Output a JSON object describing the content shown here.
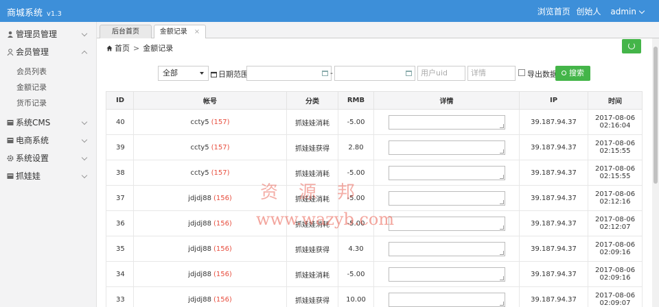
{
  "app": {
    "title": "商城系统",
    "version": "v1.3"
  },
  "topbar": {
    "links": [
      "浏览首页",
      "创始人",
      "admin"
    ]
  },
  "sidebar": {
    "items": [
      {
        "label": "管理员管理",
        "icon": "user-icon",
        "expanded": false
      },
      {
        "label": "会员管理",
        "icon": "member-icon",
        "expanded": true,
        "children": [
          "会员列表",
          "金额记录",
          "货币记录"
        ]
      },
      {
        "label": "系统CMS",
        "icon": "cms-icon",
        "expanded": false
      },
      {
        "label": "电商系统",
        "icon": "shop-icon",
        "expanded": false
      },
      {
        "label": "系统设置",
        "icon": "gear-icon",
        "expanded": false
      },
      {
        "label": "抓娃娃",
        "icon": "doll-icon",
        "expanded": false
      }
    ]
  },
  "tabs": [
    {
      "label": "后台首页",
      "active": false
    },
    {
      "label": "金额记录",
      "active": true,
      "close": "×"
    }
  ],
  "breadcrumb": {
    "home": "首页",
    "sep": ">",
    "current": "金额记录"
  },
  "filters": {
    "category_selected": "全部",
    "date_label": "日期范围:",
    "dash": "-",
    "uid_placeholder": "用户uid",
    "detail_placeholder": "详情",
    "export_label": "导出数据",
    "search_label": "搜索"
  },
  "table": {
    "columns": [
      "ID",
      "帐号",
      "分类",
      "RMB",
      "详情",
      "IP",
      "时间"
    ],
    "rows": [
      {
        "id": "40",
        "account": "ccty5",
        "uid": "(157)",
        "category": "抓娃娃消耗",
        "rmb": "-5.00",
        "ip": "39.187.94.37",
        "time": "2017-08-06 02:16:04"
      },
      {
        "id": "39",
        "account": "ccty5",
        "uid": "(157)",
        "category": "抓娃娃获得",
        "rmb": "2.80",
        "ip": "39.187.94.37",
        "time": "2017-08-06 02:15:55"
      },
      {
        "id": "38",
        "account": "ccty5",
        "uid": "(157)",
        "category": "抓娃娃消耗",
        "rmb": "-5.00",
        "ip": "39.187.94.37",
        "time": "2017-08-06 02:15:55"
      },
      {
        "id": "37",
        "account": "jdjdj88",
        "uid": "(156)",
        "category": "抓娃娃消耗",
        "rmb": "-5.00",
        "ip": "39.187.94.37",
        "time": "2017-08-06 02:12:16"
      },
      {
        "id": "36",
        "account": "jdjdj88",
        "uid": "(156)",
        "category": "抓娃娃消耗",
        "rmb": "-5.00",
        "ip": "39.187.94.37",
        "time": "2017-08-06 02:12:07"
      },
      {
        "id": "35",
        "account": "jdjdj88",
        "uid": "(156)",
        "category": "抓娃娃获得",
        "rmb": "4.30",
        "ip": "39.187.94.37",
        "time": "2017-08-06 02:09:16"
      },
      {
        "id": "34",
        "account": "jdjdj88",
        "uid": "(156)",
        "category": "抓娃娃消耗",
        "rmb": "-5.00",
        "ip": "39.187.94.37",
        "time": "2017-08-06 02:09:16"
      },
      {
        "id": "33",
        "account": "jdjdj88",
        "uid": "(156)",
        "category": "抓娃娃获得",
        "rmb": "10.00",
        "ip": "39.187.94.37",
        "time": "2017-08-06 02:09:07"
      }
    ]
  },
  "watermark": {
    "cn": "资源邦",
    "url": "www.wazyb.com"
  },
  "colors": {
    "topbar": "#3d8fd9",
    "accent_green": "#44b549",
    "negative": "#e74c3c",
    "positive": "#2e9a2e"
  }
}
